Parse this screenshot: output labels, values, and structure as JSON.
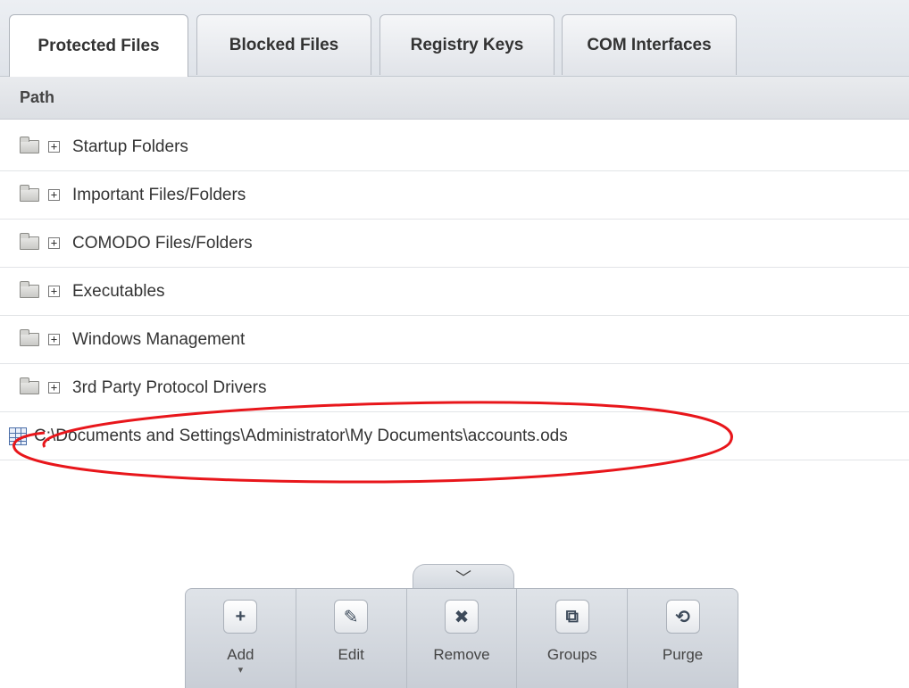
{
  "tabs": [
    {
      "label": "Protected Files",
      "active": true
    },
    {
      "label": "Blocked Files",
      "active": false
    },
    {
      "label": "Registry Keys",
      "active": false
    },
    {
      "label": "COM Interfaces",
      "active": false
    }
  ],
  "table": {
    "column_header": "Path",
    "groups": [
      {
        "label": "Startup Folders",
        "expander": "+"
      },
      {
        "label": "Important Files/Folders",
        "expander": "+"
      },
      {
        "label": "COMODO Files/Folders",
        "expander": "+"
      },
      {
        "label": "Executables",
        "expander": "+"
      },
      {
        "label": "Windows Management",
        "expander": "+"
      },
      {
        "label": "3rd Party Protocol Drivers",
        "expander": "+"
      }
    ],
    "file_row": {
      "path": "C:\\Documents and Settings\\Administrator\\My Documents\\accounts.ods"
    }
  },
  "toolbar": {
    "handle_glyph": "﹀",
    "buttons": [
      {
        "label": "Add",
        "icon": "plus-icon",
        "glyph": "+",
        "caret": "▾"
      },
      {
        "label": "Edit",
        "icon": "pencil-icon",
        "glyph": "✎"
      },
      {
        "label": "Remove",
        "icon": "close-icon",
        "glyph": "✖"
      },
      {
        "label": "Groups",
        "icon": "groups-icon",
        "glyph": "⧉"
      },
      {
        "label": "Purge",
        "icon": "refresh-icon",
        "glyph": "⟲"
      }
    ]
  },
  "colors": {
    "annotation": "#e8161b",
    "accent": "#4b6ea8"
  }
}
